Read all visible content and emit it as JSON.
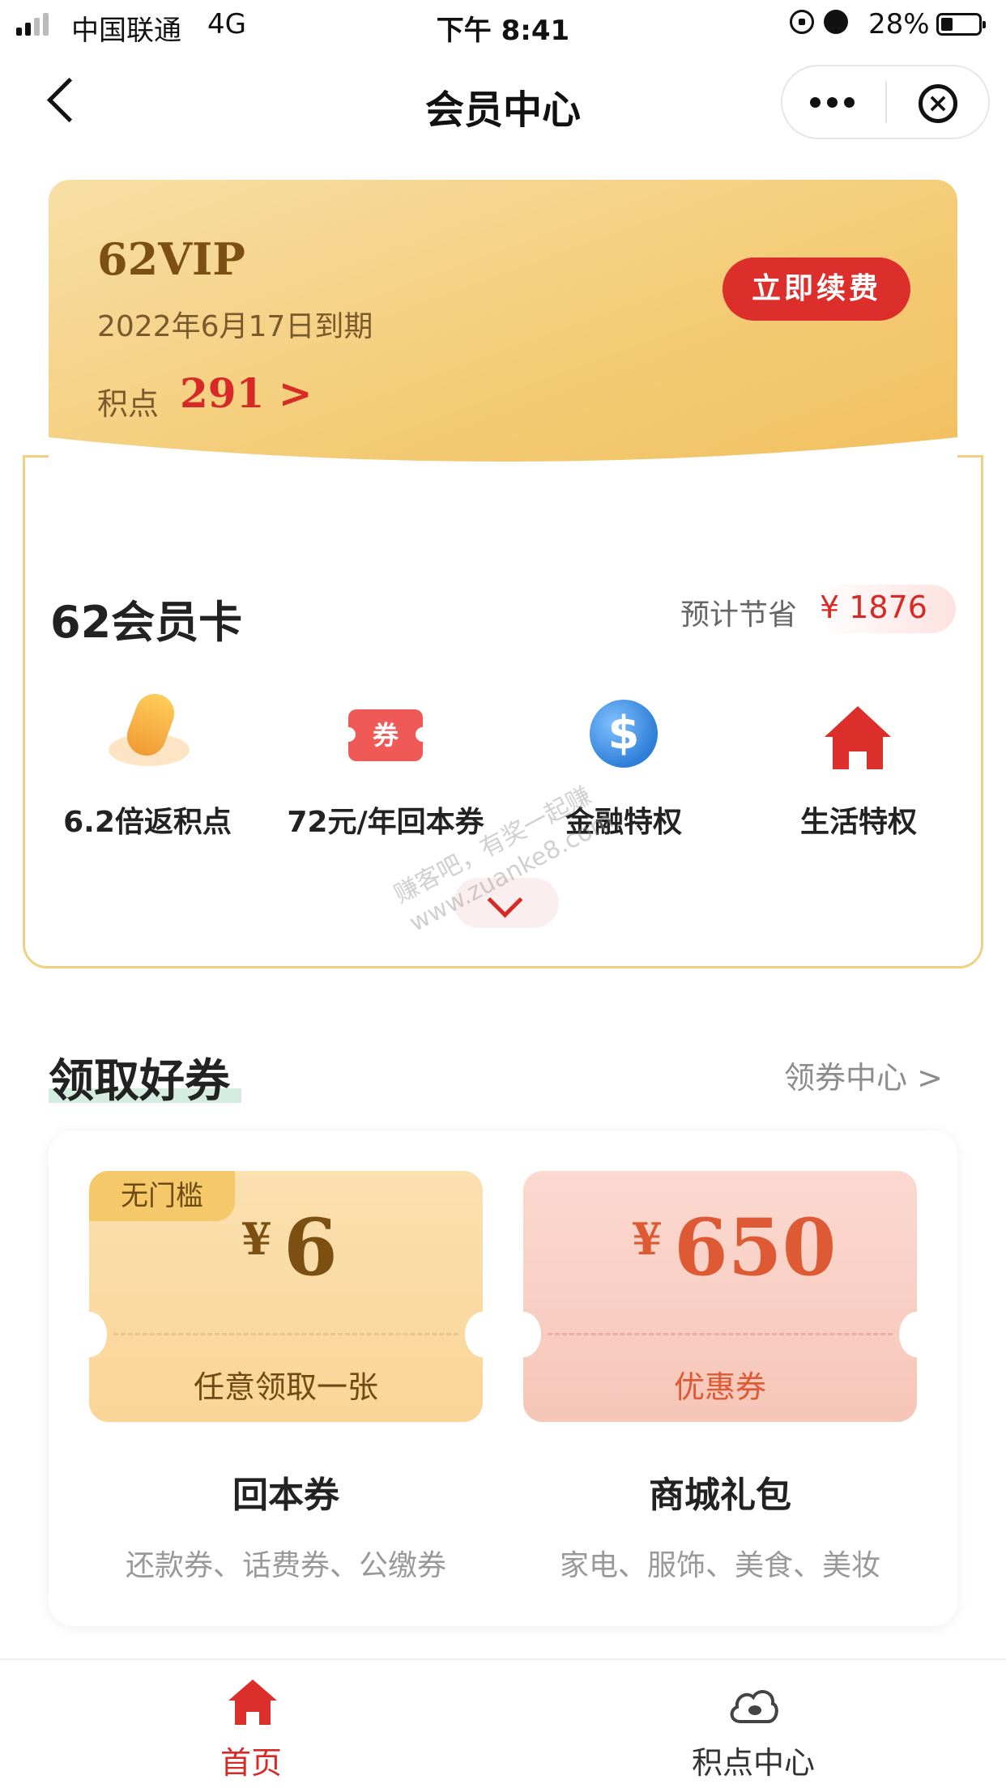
{
  "status_bar": {
    "carrier": "中国联通",
    "network": "4G",
    "time": "下午 8:41",
    "battery": "28%"
  },
  "nav": {
    "title": "会员中心"
  },
  "vip_card": {
    "level": "62VIP",
    "expiry": "2022年6月17日到期",
    "points_label": "积点",
    "points_value": "291 >",
    "renew_button": "立即续费"
  },
  "member_card": {
    "title": "62会员卡",
    "savings_label": "预计节省",
    "savings_value": "¥ 1876",
    "perks": [
      {
        "label": "6.2倍返积点",
        "icon": "gold-bean-icon"
      },
      {
        "label": "72元/年回本券",
        "icon": "coupon-icon",
        "icon_text": "券"
      },
      {
        "label": "金融特权",
        "icon": "finance-globe-icon"
      },
      {
        "label": "生活特权",
        "icon": "house-icon"
      }
    ]
  },
  "coupons_section": {
    "title": "领取好券",
    "link": "领券中心 >",
    "items": [
      {
        "badge": "无门槛",
        "currency": "¥",
        "amount": "6",
        "subtitle": "任意领取一张",
        "name": "回本券",
        "desc": "还款券、话费券、公缴券",
        "color": "#7b5012"
      },
      {
        "currency": "¥",
        "amount": "650",
        "subtitle": "优惠券",
        "name": "商城礼包",
        "desc": "家电、服饰、美食、美妆",
        "color": "#dd5a35"
      }
    ]
  },
  "tab_bar": {
    "tabs": [
      {
        "label": "首页",
        "icon": "home-icon",
        "active": true,
        "color": "#d72a27"
      },
      {
        "label": "积点中心",
        "icon": "points-cloud-icon",
        "active": false,
        "color": "#333333"
      }
    ]
  },
  "watermark": {
    "line1": "赚客吧，有奖一起赚",
    "line2": "www.zuanke8.com"
  },
  "colors": {
    "accent_red": "#d72a27",
    "gold": "#f4cd79"
  }
}
